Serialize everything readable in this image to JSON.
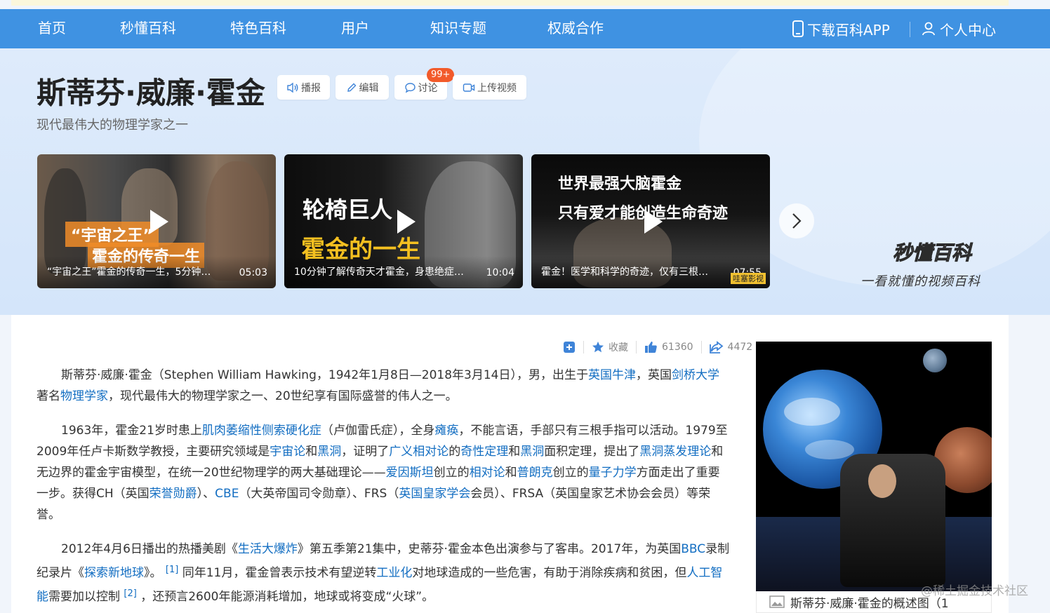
{
  "nav": {
    "items": [
      "首页",
      "秒懂百科",
      "特色百科",
      "用户",
      "知识专题",
      "权威合作"
    ],
    "download_app": "下载百科APP",
    "user_center": "个人中心"
  },
  "entry": {
    "title": "斯蒂芬·威廉·霍金",
    "subtitle": "现代最伟大的物理学家之一",
    "buttons": {
      "broadcast": "播报",
      "edit": "编辑",
      "discuss": "讨论",
      "upload_video": "上传视频"
    },
    "discuss_badge": "99+"
  },
  "videos": [
    {
      "overlay1": "“宇宙之王”",
      "overlay2": "霍金的传奇一生",
      "title": "“宇宙之王”霍金的传奇一生，5分钟…",
      "duration": "05:03"
    },
    {
      "overlay1": "轮椅巨人",
      "overlay2": "霍金的一生",
      "title": "10分钟了解传奇天才霍金，身患绝症…",
      "duration": "10:04"
    },
    {
      "overlay1": "世界最强大脑霍金",
      "overlay2": "只有爱才能创造生命奇迹",
      "title": "霍金！医学和科学的奇迹，仅有三根…",
      "duration": "07:55",
      "watermark": "哇塞影视"
    }
  ],
  "brand": {
    "logo": "秒懂百科",
    "slogan": "一看就懂的视频百科"
  },
  "actions": {
    "favorite": "收藏",
    "likes": "61360",
    "shares": "4472"
  },
  "paragraphs": {
    "p1": {
      "t1": "斯蒂芬·威廉·霍金（Stephen William Hawking，1942年1月8日—2018年3月14日），男，出生于",
      "l1": "英国牛津",
      "t2": "，英国",
      "l2": "剑桥大学",
      "t3": "著名",
      "l3": "物理学家",
      "t4": "，现代最伟大的物理学家之一、20世纪享有国际盛誉的伟人之一。"
    },
    "p2": {
      "t1": "1963年，霍金21岁时患上",
      "l1": "肌肉萎缩性侧索硬化症",
      "t2": "（卢伽雷氏症），全身",
      "l2": "瘫痪",
      "t3": "，不能言语，手部只有三根手指可以活动。1979至2009年任卢卡斯数学教授，主要研究领域是",
      "l3": "宇宙论",
      "t4": "和",
      "l4": "黑洞",
      "t5": "，证明了",
      "l5": "广义相对论",
      "t6": "的",
      "l6": "奇性定理",
      "t7": "和",
      "l7": "黑洞",
      "t8": "面积定理，提出了",
      "l8": "黑洞蒸发理论",
      "t9": "和无边界的霍金宇宙模型，在统一20世纪物理学的两大基础理论——",
      "l9": "爱因斯坦",
      "t10": "创立的",
      "l10": "相对论",
      "t11": "和",
      "l11": "普朗克",
      "t12": "创立的",
      "l12": "量子力学",
      "t13": "方面走出了重要一步。获得CH（英国",
      "l13": "荣誉勋爵",
      "t14": "）、",
      "l14": "CBE",
      "t15": "（大英帝国司令勋章）、FRS（",
      "l15": "英国皇家学会",
      "t16": "会员）、FRSA（英国皇家艺术协会会员）等荣誉。"
    },
    "p3": {
      "t1": "2012年4月6日播出的热播美剧《",
      "l1": "生活大爆炸",
      "t2": "》第五季第21集中，史蒂芬·霍金本色出演参与了客串。2017年，为英国",
      "l2": "BBC",
      "t3": "录制纪录片《",
      "l3": "探索新地球",
      "t4": "》。",
      "s1": "[1]",
      "t5": "同年11月，霍金曾表示技术有望逆转",
      "l4": "工业化",
      "t6": "对地球造成的一些危害，有助于消除疾病和贫困，但",
      "l5": "人工智能",
      "t7": "需要加以控制",
      "s2": "[2]",
      "t8": "，还预言2600年能源消耗增加，地球或将变成“火球”。"
    }
  },
  "side_image": {
    "caption": "斯蒂芬·威廉·霍金的概述图（1"
  },
  "watermark": "@稀土掘金技术社区",
  "colors": {
    "nav_bg": "#3f92e2",
    "link": "#136ec2",
    "badge": "#f25a2a"
  }
}
